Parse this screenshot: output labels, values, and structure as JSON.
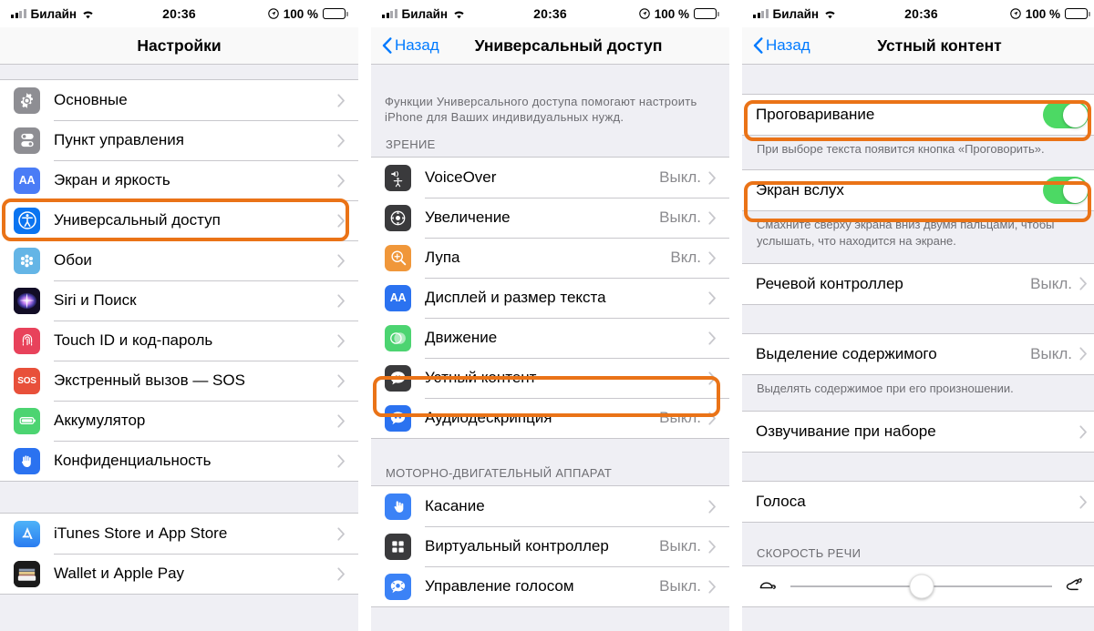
{
  "status_bar": {
    "carrier": "Билайн",
    "time": "20:36",
    "battery_percent": "100 %"
  },
  "colors": {
    "highlight": "#ea7317",
    "tint": "#007aff",
    "toggle_on": "#4cd964",
    "group_bg": "#efeff4"
  },
  "screens": [
    {
      "id": "settings",
      "nav": {
        "title": "Настройки",
        "back_label": null
      },
      "groups": [
        {
          "rows": [
            {
              "label": "Основные",
              "value": "",
              "icon": "gear-icon",
              "icon_bg": "#8e8e93"
            },
            {
              "label": "Пункт управления",
              "value": "",
              "icon": "control-center-icon",
              "icon_bg": "#8e8e93"
            },
            {
              "label": "Экран и яркость",
              "value": "",
              "icon": "display-brightness-icon",
              "icon_bg": "#4a7cf6"
            },
            {
              "label": "Универсальный доступ",
              "value": "",
              "icon": "accessibility-icon",
              "icon_bg": "#0a74f0",
              "highlighted": true
            },
            {
              "label": "Обои",
              "value": "",
              "icon": "wallpaper-icon",
              "icon_bg": "#64b5e6"
            },
            {
              "label": "Siri и Поиск",
              "value": "",
              "icon": "siri-icon",
              "icon_bg": "#1b1b2e"
            },
            {
              "label": "Touch ID и код-пароль",
              "value": "",
              "icon": "touch-id-icon",
              "icon_bg": "#e8425b"
            },
            {
              "label": "Экстренный вызов — SOS",
              "value": "",
              "icon": "sos-icon",
              "icon_bg": "#e8503a"
            },
            {
              "label": "Аккумулятор",
              "value": "",
              "icon": "battery-icon",
              "icon_bg": "#4cd471"
            },
            {
              "label": "Конфиденциальность",
              "value": "",
              "icon": "privacy-hand-icon",
              "icon_bg": "#2b72f0"
            }
          ]
        },
        {
          "rows": [
            {
              "label": "iTunes Store и App Store",
              "value": "",
              "icon": "app-store-icon",
              "icon_bg": "#3b9ef5"
            },
            {
              "label": "Wallet и Apple Pay",
              "value": "",
              "icon": "wallet-icon",
              "icon_bg": "#1b1b1b"
            }
          ]
        }
      ]
    },
    {
      "id": "accessibility",
      "nav": {
        "title": "Универсальный доступ",
        "back_label": "Назад"
      },
      "intro": "Функции Универсального доступа помогают настроить iPhone для Ваших индивидуальных нужд.",
      "sections": [
        {
          "head": "ЗРЕНИЕ",
          "rows": [
            {
              "label": "VoiceOver",
              "value": "Выкл.",
              "icon": "voiceover-icon",
              "icon_bg": "#3a3a3c"
            },
            {
              "label": "Увеличение",
              "value": "Выкл.",
              "icon": "zoom-icon",
              "icon_bg": "#3a3a3c"
            },
            {
              "label": "Лупа",
              "value": "Вкл.",
              "icon": "magnifier-icon",
              "icon_bg": "#f0973a"
            },
            {
              "label": "Дисплей и размер текста",
              "value": "",
              "icon": "display-text-size-icon",
              "icon_bg": "#2b72f0"
            },
            {
              "label": "Движение",
              "value": "",
              "icon": "motion-icon",
              "icon_bg": "#4cd471"
            },
            {
              "label": "Устный контент",
              "value": "",
              "icon": "spoken-content-icon",
              "icon_bg": "#3a3a3c",
              "highlighted": true
            },
            {
              "label": "Аудиодескрипция",
              "value": "Выкл.",
              "icon": "audio-descriptions-icon",
              "icon_bg": "#2b72f0"
            }
          ]
        },
        {
          "head": "МОТОРНО-ДВИГАТЕЛЬНЫЙ АППАРАТ",
          "rows": [
            {
              "label": "Касание",
              "value": "",
              "icon": "touch-icon",
              "icon_bg": "#3b82f6"
            },
            {
              "label": "Виртуальный контроллер",
              "value": "Выкл.",
              "icon": "switch-control-icon",
              "icon_bg": "#3a3a3c"
            },
            {
              "label": "Управление голосом",
              "value": "Выкл.",
              "icon": "voice-control-icon",
              "icon_bg": "#3b82f6"
            }
          ]
        }
      ]
    },
    {
      "id": "spoken-content",
      "nav": {
        "title": "Устный контент",
        "back_label": "Назад"
      },
      "blocks": [
        {
          "type": "toggle",
          "label": "Проговаривание",
          "on": true,
          "highlighted": true,
          "footnote": "При выборе текста появится кнопка «Проговорить»."
        },
        {
          "type": "toggle",
          "label": "Экран вслух",
          "on": true,
          "highlighted": true,
          "footnote": "Смахните сверху экрана вниз двумя пальцами, чтобы услышать, что находится на экране."
        },
        {
          "type": "row",
          "label": "Речевой контроллер",
          "value": "Выкл."
        },
        {
          "type": "row",
          "label": "Выделение содержимого",
          "value": "Выкл.",
          "footnote": "Выделять содержимое при его произношении."
        },
        {
          "type": "row",
          "label": "Озвучивание при наборе",
          "value": ""
        },
        {
          "type": "row",
          "label": "Голоса",
          "value": ""
        }
      ],
      "speech_rate": {
        "head": "СКОРОСТЬ РЕЧИ",
        "left_icon": "tortoise-icon",
        "right_icon": "hare-icon",
        "position_percent": 50
      }
    }
  ]
}
